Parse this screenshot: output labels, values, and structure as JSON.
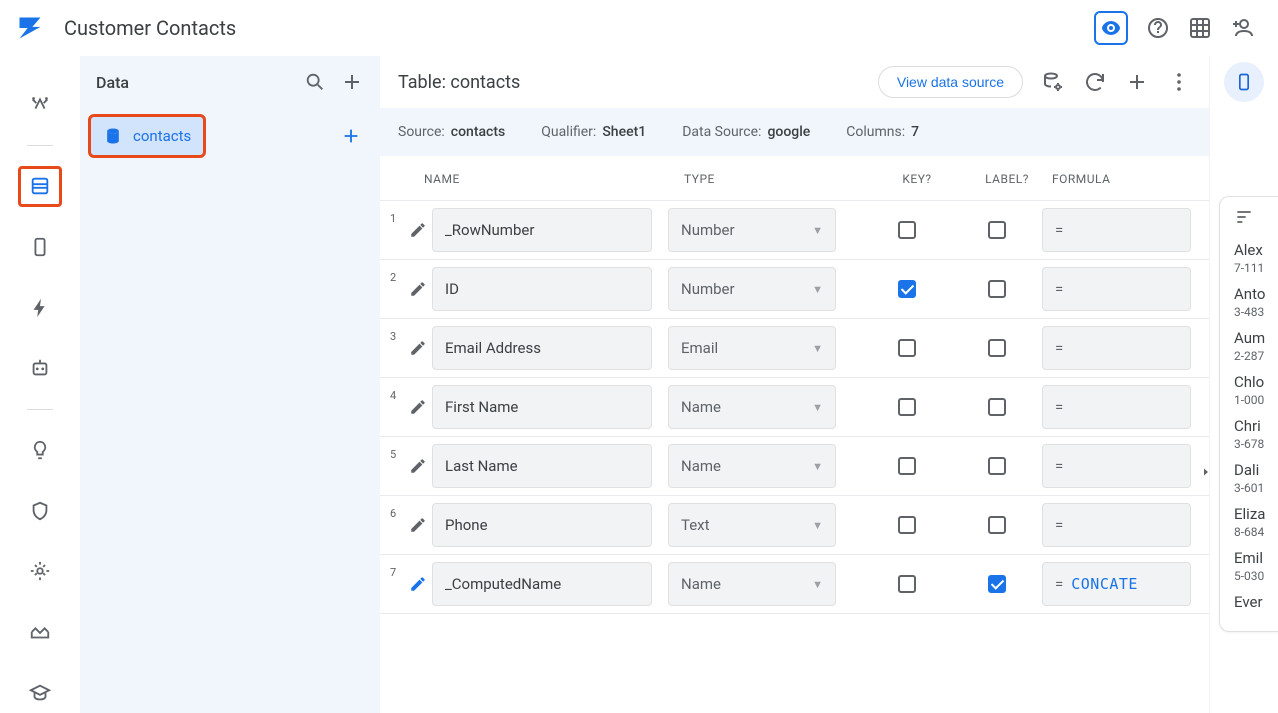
{
  "topbar": {
    "title": "Customer Contacts"
  },
  "sidebar": {
    "header": "Data",
    "item_label": "contacts"
  },
  "editor": {
    "title_prefix": "Table: ",
    "title_value": "contacts",
    "view_source_label": "View data source",
    "meta": {
      "source_k": "Source:",
      "source_v": "contacts",
      "qualifier_k": "Qualifier:",
      "qualifier_v": "Sheet1",
      "datasource_k": "Data Source:",
      "datasource_v": "google",
      "columns_k": "Columns:",
      "columns_v": "7"
    },
    "cols": {
      "name": "NAME",
      "type": "TYPE",
      "key": "KEY?",
      "label": "LABEL?",
      "formula": "FORMULA"
    },
    "rows": [
      {
        "n": "1",
        "name": "_RowNumber",
        "type": "Number",
        "key": false,
        "label": false,
        "formula": "=",
        "code": "",
        "editblue": false
      },
      {
        "n": "2",
        "name": "ID",
        "type": "Number",
        "key": true,
        "label": false,
        "formula": "=",
        "code": "",
        "editblue": false
      },
      {
        "n": "3",
        "name": "Email Address",
        "type": "Email",
        "key": false,
        "label": false,
        "formula": "=",
        "code": "",
        "editblue": false
      },
      {
        "n": "4",
        "name": "First Name",
        "type": "Name",
        "key": false,
        "label": false,
        "formula": "=",
        "code": "",
        "editblue": false
      },
      {
        "n": "5",
        "name": "Last Name",
        "type": "Name",
        "key": false,
        "label": false,
        "formula": "=",
        "code": "",
        "editblue": false
      },
      {
        "n": "6",
        "name": "Phone",
        "type": "Text",
        "key": false,
        "label": false,
        "formula": "=",
        "code": "",
        "editblue": false
      },
      {
        "n": "7",
        "name": "_ComputedName",
        "type": "Name",
        "key": false,
        "label": true,
        "formula": "=",
        "code": "CONCATE",
        "editblue": true
      }
    ]
  },
  "preview": {
    "entries": [
      {
        "nm": "Alex",
        "sub": "7-111"
      },
      {
        "nm": "Anto",
        "sub": "3-483"
      },
      {
        "nm": "Aum",
        "sub": "2-287"
      },
      {
        "nm": "Chlo",
        "sub": "1-000"
      },
      {
        "nm": "Chri",
        "sub": "3-678"
      },
      {
        "nm": "Dali",
        "sub": "3-601"
      },
      {
        "nm": "Eliza",
        "sub": "8-684"
      },
      {
        "nm": "Emil",
        "sub": "5-030"
      },
      {
        "nm": "Ever",
        "sub": ""
      }
    ]
  }
}
